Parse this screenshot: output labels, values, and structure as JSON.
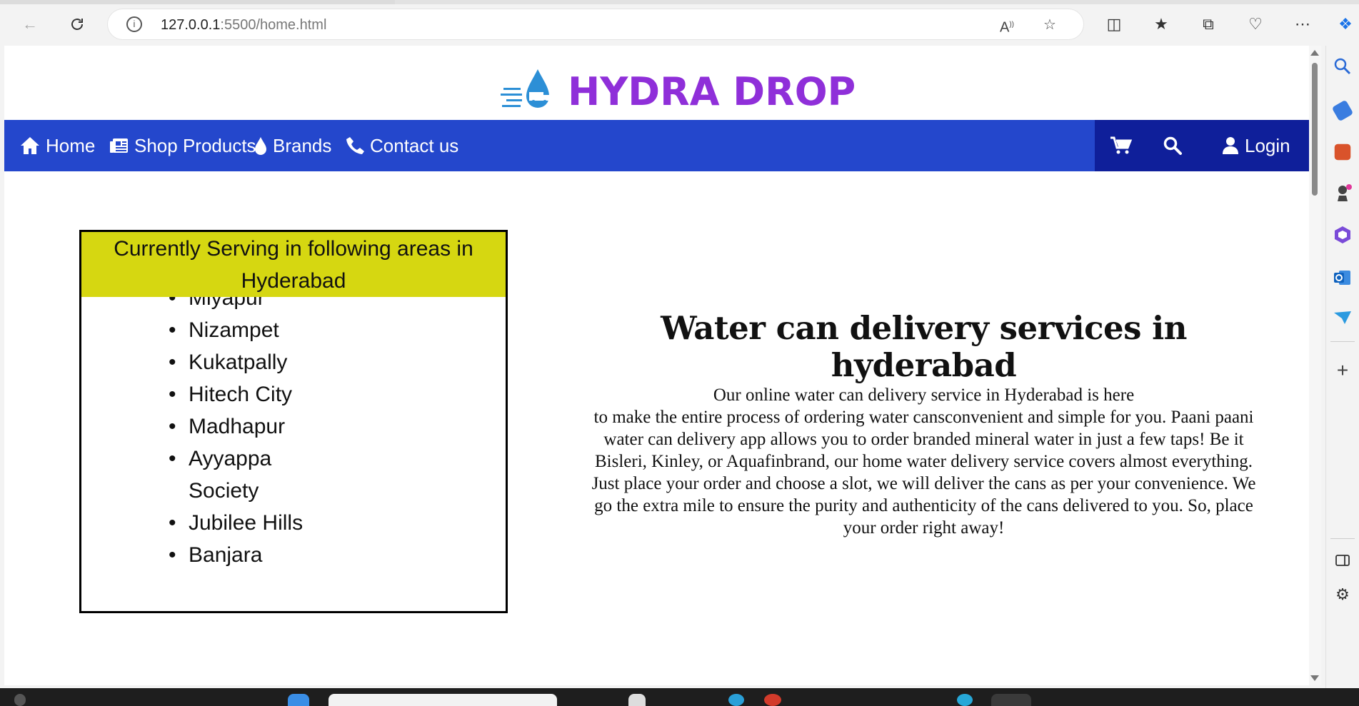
{
  "browser": {
    "url_host": "127.0.0.1",
    "url_path": ":5500/home.html"
  },
  "site": {
    "brand": "HYDRA DROP",
    "nav": {
      "home": "Home",
      "shop": "Shop Products",
      "brands": "Brands",
      "contact": "Contact us",
      "login": "Login"
    },
    "areas": {
      "heading": "Currently Serving in following areas in Hyderabad",
      "items": [
        "Miyapur",
        "Nizampet",
        "Kukatpally",
        "Hitech City",
        "Madhapur",
        "Ayyappa Society",
        "Jubilee Hills",
        "Banjara"
      ]
    },
    "content": {
      "title": "Water can delivery services in hyderabad",
      "line1": "Our online water can delivery service in Hyderabad is here",
      "line2": "to make the entire process of ordering water cansconvenient and simple for you. Paani paani water can delivery app allows you to order branded mineral water in just a few taps! Be it Bisleri, Kinley, or Aquafinbrand, our home water delivery service covers almost everything. Just place your order and choose a slot, we will deliver the cans as per your convenience. We go the extra mile to ensure the purity and authenticity of the cans delivered to you. So, place your order right away!"
    }
  },
  "colors": {
    "brand_purple": "#8f2fd9",
    "nav_blue": "#2447cc",
    "nav_dark": "#0f1f9a",
    "area_header": "#d6d711"
  }
}
